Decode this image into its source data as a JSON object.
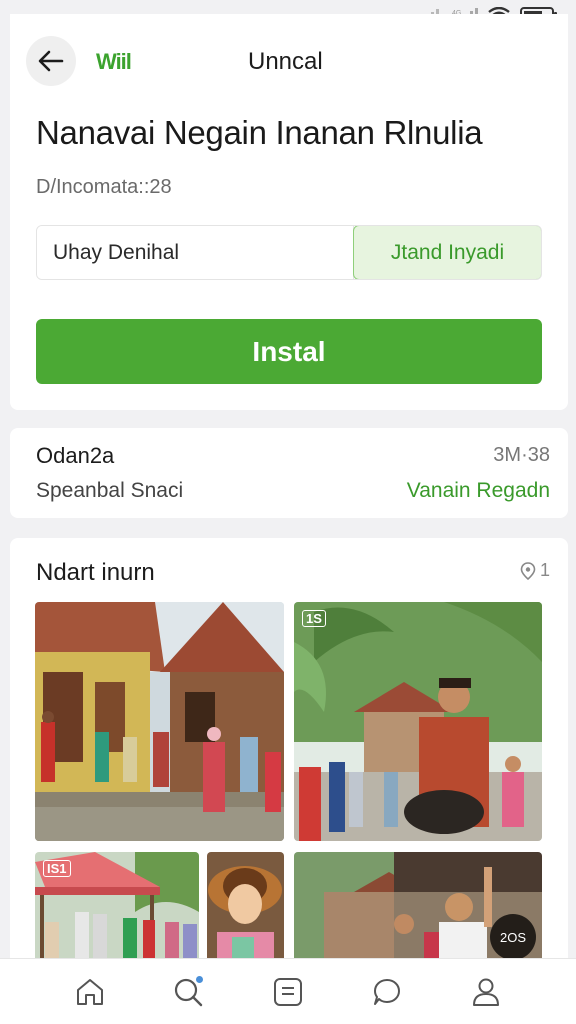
{
  "status_bar": {
    "icons": [
      "signal-icon",
      "signal-icon",
      "wifi-icon",
      "battery-icon"
    ]
  },
  "header": {
    "brand": "Wiil",
    "title": "Unncal"
  },
  "app": {
    "name": "Nanavai Negain Inanan Rlnulia",
    "meta": "D/Incomata::28",
    "choice_left": "Uhay Denihal",
    "choice_right": "Jtand Inyadi",
    "install_label": "Instal"
  },
  "info": {
    "title": "Odan2a",
    "size": "3M·38",
    "subtitle": "Speanbal Snaci",
    "link": "Vanain Regadn"
  },
  "gallery": {
    "title": "Ndart inurn",
    "count": "1",
    "photos": [
      {
        "name": "photo-village-houses"
      },
      {
        "name": "photo-palm-house",
        "tag": "1S"
      },
      {
        "name": "photo-market-tent",
        "tag": "IS1"
      },
      {
        "name": "photo-child-hat"
      },
      {
        "name": "photo-street-crowd",
        "badge": "2OS"
      }
    ]
  },
  "bottom_nav": {
    "items": [
      "home-icon",
      "search-icon",
      "apps-icon",
      "chat-icon",
      "profile-icon"
    ]
  },
  "colors": {
    "accent": "#4ba934",
    "accent_text": "#3a9a2b",
    "accent_light": "#e7f4df"
  }
}
